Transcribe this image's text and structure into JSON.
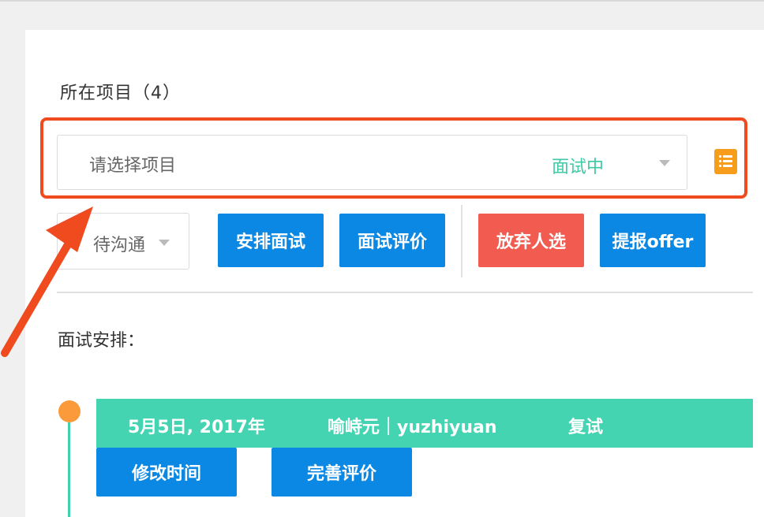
{
  "project_section": {
    "title": "所在项目（4）",
    "select": {
      "placeholder": "请选择项目",
      "status": "面试中"
    }
  },
  "status_select": {
    "value": "待沟通"
  },
  "actions": {
    "arrange_interview": "安排面试",
    "interview_review": "面试评价",
    "abandon_candidate": "放弃人选",
    "submit_offer": "提报offer"
  },
  "interview_section": {
    "title": "面试安排：",
    "items": [
      {
        "date": "5月5日, 2017年",
        "interviewer": "喻峙元｜yuzhiyuan",
        "round": "复试",
        "buttons": {
          "edit_time": "修改时间",
          "complete_review": "完善评价"
        }
      }
    ]
  },
  "colors": {
    "highlight": "#f04a1f",
    "primary": "#0a88e3",
    "danger": "#f25b50",
    "teal": "#45d4b2",
    "orange": "#f89c1c"
  },
  "icons": {
    "list": "list-icon",
    "dropdown": "chevron-down-icon",
    "timeline_dot": "timeline-dot",
    "annotation": "arrow-annotation"
  }
}
